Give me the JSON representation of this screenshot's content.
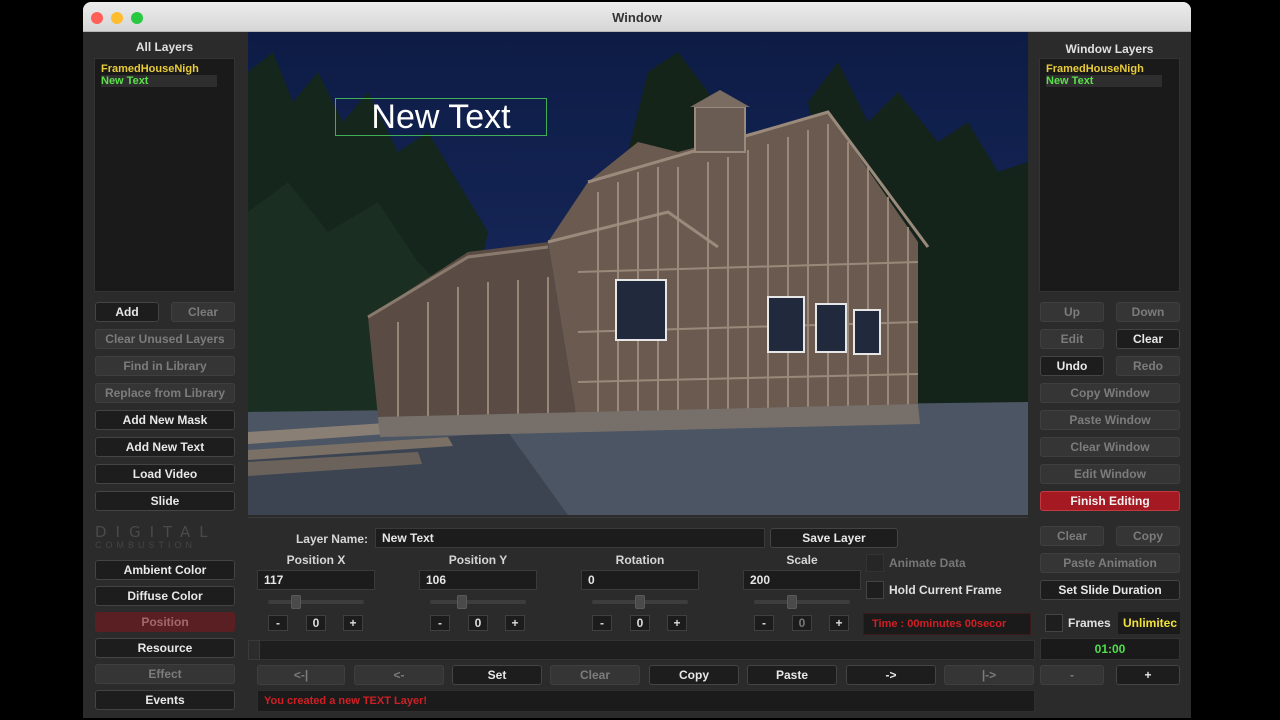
{
  "window": {
    "title": "Window"
  },
  "left": {
    "title": "All Layers",
    "layers": [
      {
        "name": "FramedHouseNigh",
        "color": "#e8cc3a"
      },
      {
        "name": "New Text",
        "color": "#5ce04a"
      }
    ],
    "add": "Add",
    "clear": "Clear",
    "clear_unused": "Clear Unused Layers",
    "find_library": "Find in Library",
    "replace_library": "Replace from Library",
    "add_mask": "Add New Mask",
    "add_text": "Add New Text",
    "load_video": "Load Video",
    "slide": "Slide"
  },
  "logo": {
    "line1": "DIGITAL",
    "line2": "COMBUSTION"
  },
  "canvas": {
    "overlay_text": "New Text"
  },
  "right": {
    "title": "Window Layers",
    "layers": [
      {
        "name": "FramedHouseNigh",
        "color": "#e8cc3a"
      },
      {
        "name": "New Text",
        "color": "#5ce04a"
      }
    ],
    "up": "Up",
    "down": "Down",
    "edit": "Edit",
    "clear": "Clear",
    "undo": "Undo",
    "redo": "Redo",
    "copy_window": "Copy Window",
    "paste_window": "Paste Window",
    "clear_window": "Clear Window",
    "edit_window": "Edit Window",
    "finish_editing": "Finish Editing"
  },
  "props": {
    "layer_name_label": "Layer Name:",
    "layer_name": "New Text",
    "save_layer": "Save Layer",
    "position_x": {
      "label": "Position X",
      "value": "117",
      "step": "0"
    },
    "position_y": {
      "label": "Position Y",
      "value": "106",
      "step": "0"
    },
    "rotation": {
      "label": "Rotation",
      "value": "0",
      "step": "0"
    },
    "scale": {
      "label": "Scale",
      "value": "200",
      "step": "0"
    },
    "minus": "-",
    "plus": "+"
  },
  "modes": {
    "ambient": "Ambient Color",
    "diffuse": "Diffuse Color",
    "position": "Position",
    "resource": "Resource",
    "effect": "Effect",
    "events": "Events"
  },
  "anim": {
    "clear": "Clear",
    "copy": "Copy",
    "animate_data": "Animate Data",
    "paste_animation": "Paste Animation",
    "hold_current_frame": "Hold Current Frame",
    "set_slide_duration": "Set Slide Duration",
    "time": "Time : 00minutes 00secor",
    "frames_label": "Frames",
    "frames_value": "Unlimitec",
    "timecode": "01:00",
    "minus": "-",
    "plus": "+"
  },
  "timeline": {
    "first": "<-|",
    "prev": "<-",
    "set": "Set",
    "clear": "Clear",
    "copy": "Copy",
    "paste": "Paste",
    "next": "->",
    "last": "|->"
  },
  "status": {
    "message": "You created a new TEXT Layer!"
  }
}
